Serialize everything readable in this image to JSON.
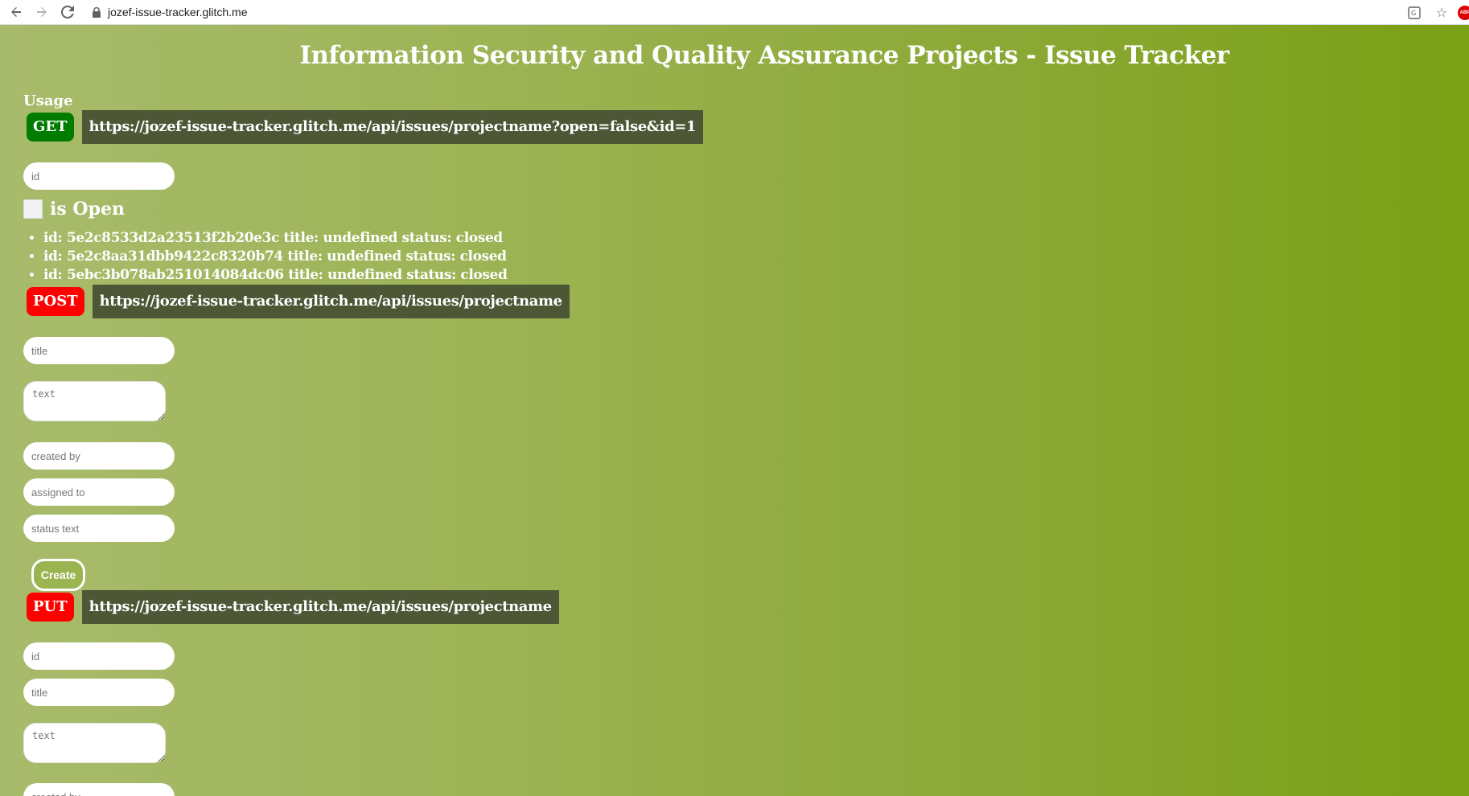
{
  "browser": {
    "url": "jozef-issue-tracker.glitch.me",
    "extension_badge": "ABP"
  },
  "page": {
    "title": "Information Security and Quality Assurance Projects - Issue Tracker",
    "usage_label": "Usage",
    "get": {
      "method": "GET",
      "url": "https://jozef-issue-tracker.glitch.me/api/issues/projectname?open=false&id=1",
      "id_placeholder": "id",
      "is_open_label": "is Open",
      "is_open_checked": false,
      "results": [
        "id: 5e2c8533d2a23513f2b20e3c title: undefined status: closed",
        "id: 5e2c8aa31dbb9422c8320b74 title: undefined status: closed",
        "id: 5ebc3b078ab251014084dc06 title: undefined status: closed"
      ]
    },
    "post": {
      "method": "POST",
      "url": "https://jozef-issue-tracker.glitch.me/api/issues/projectname",
      "title_placeholder": "title",
      "text_placeholder": "text",
      "created_by_placeholder": "created by",
      "assigned_to_placeholder": "assigned to",
      "status_text_placeholder": "status text",
      "create_label": "Create"
    },
    "put": {
      "method": "PUT",
      "url": "https://jozef-issue-tracker.glitch.me/api/issues/projectname",
      "id_placeholder": "id",
      "title_placeholder": "title",
      "text_placeholder": "text",
      "created_by_placeholder": "created by"
    }
  },
  "colors": {
    "get_badge": "#007d00",
    "post_badge": "#ff0000",
    "put_badge": "#ff0000",
    "url_box": "#4d5736",
    "gradient_left": "#a8bb6c",
    "gradient_right": "#7aa014"
  }
}
